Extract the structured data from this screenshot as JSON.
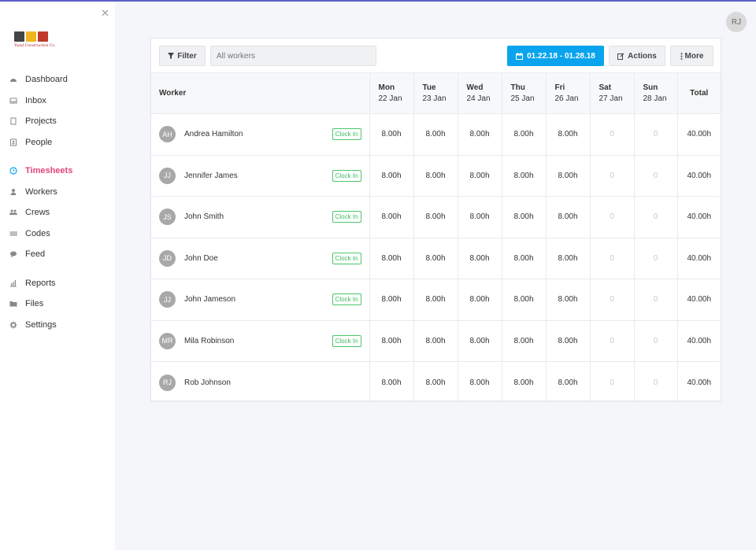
{
  "sidebar": {
    "close_glyph": "✕",
    "logo_caption": "Yusuf Construction Co.",
    "items": [
      {
        "label": "Dashboard",
        "icon": "dashboard-icon"
      },
      {
        "label": "Inbox",
        "icon": "inbox-icon"
      },
      {
        "label": "Projects",
        "icon": "projects-icon"
      },
      {
        "label": "People",
        "icon": "people-icon"
      },
      {
        "label": "Timesheets",
        "icon": "clock-icon",
        "active": true
      },
      {
        "label": "Workers",
        "icon": "worker-icon"
      },
      {
        "label": "Crews",
        "icon": "crews-icon"
      },
      {
        "label": "Codes",
        "icon": "barcode-icon"
      },
      {
        "label": "Feed",
        "icon": "feed-icon"
      },
      {
        "label": "Reports",
        "icon": "chart-icon"
      },
      {
        "label": "Files",
        "icon": "folder-icon"
      },
      {
        "label": "Settings",
        "icon": "gear-icon"
      }
    ],
    "active_color": "#e2477b"
  },
  "user": {
    "initials": "RJ"
  },
  "toolbar": {
    "filter_label": "Filter",
    "search_placeholder": "All workers",
    "date_range": "01.22.18 - 01.28.18",
    "actions_label": "Actions",
    "more_label": "More",
    "accent": "#0aa4ee"
  },
  "table": {
    "worker_header": "Worker",
    "total_header": "Total",
    "days": [
      {
        "name": "Mon",
        "date": "22 Jan"
      },
      {
        "name": "Tue",
        "date": "23 Jan"
      },
      {
        "name": "Wed",
        "date": "24 Jan"
      },
      {
        "name": "Thu",
        "date": "25 Jan"
      },
      {
        "name": "Fri",
        "date": "26 Jan"
      },
      {
        "name": "Sat",
        "date": "27 Jan"
      },
      {
        "name": "Sun",
        "date": "28 Jan"
      }
    ],
    "clock_in_label": "Clock In",
    "rows": [
      {
        "initials": "AH",
        "name": "Andrea Hamilton",
        "clock_in": true,
        "hours": [
          "8.00h",
          "8.00h",
          "8.00h",
          "8.00h",
          "8.00h",
          "0",
          "0"
        ],
        "total": "40.00h"
      },
      {
        "initials": "JJ",
        "name": "Jennifer James",
        "clock_in": true,
        "hours": [
          "8.00h",
          "8.00h",
          "8.00h",
          "8.00h",
          "8.00h",
          "0",
          "0"
        ],
        "total": "40.00h"
      },
      {
        "initials": "JS",
        "name": "John Smith",
        "clock_in": true,
        "hours": [
          "8.00h",
          "8.00h",
          "8.00h",
          "8.00h",
          "8.00h",
          "0",
          "0"
        ],
        "total": "40.00h"
      },
      {
        "initials": "JD",
        "name": "John Doe",
        "clock_in": true,
        "hours": [
          "8.00h",
          "8.00h",
          "8.00h",
          "8.00h",
          "8.00h",
          "0",
          "0"
        ],
        "total": "40.00h"
      },
      {
        "initials": "JJ",
        "name": "John Jameson",
        "clock_in": true,
        "hours": [
          "8.00h",
          "8.00h",
          "8.00h",
          "8.00h",
          "8.00h",
          "0",
          "0"
        ],
        "total": "40.00h"
      },
      {
        "initials": "MR",
        "name": "Mila Robinson",
        "clock_in": true,
        "hours": [
          "8.00h",
          "8.00h",
          "8.00h",
          "8.00h",
          "8.00h",
          "0",
          "0"
        ],
        "total": "40.00h"
      },
      {
        "initials": "RJ",
        "name": "Rob Johnson",
        "clock_in": false,
        "hours": [
          "8.00h",
          "8.00h",
          "8.00h",
          "8.00h",
          "8.00h",
          "0",
          "0"
        ],
        "total": "40.00h"
      }
    ]
  }
}
